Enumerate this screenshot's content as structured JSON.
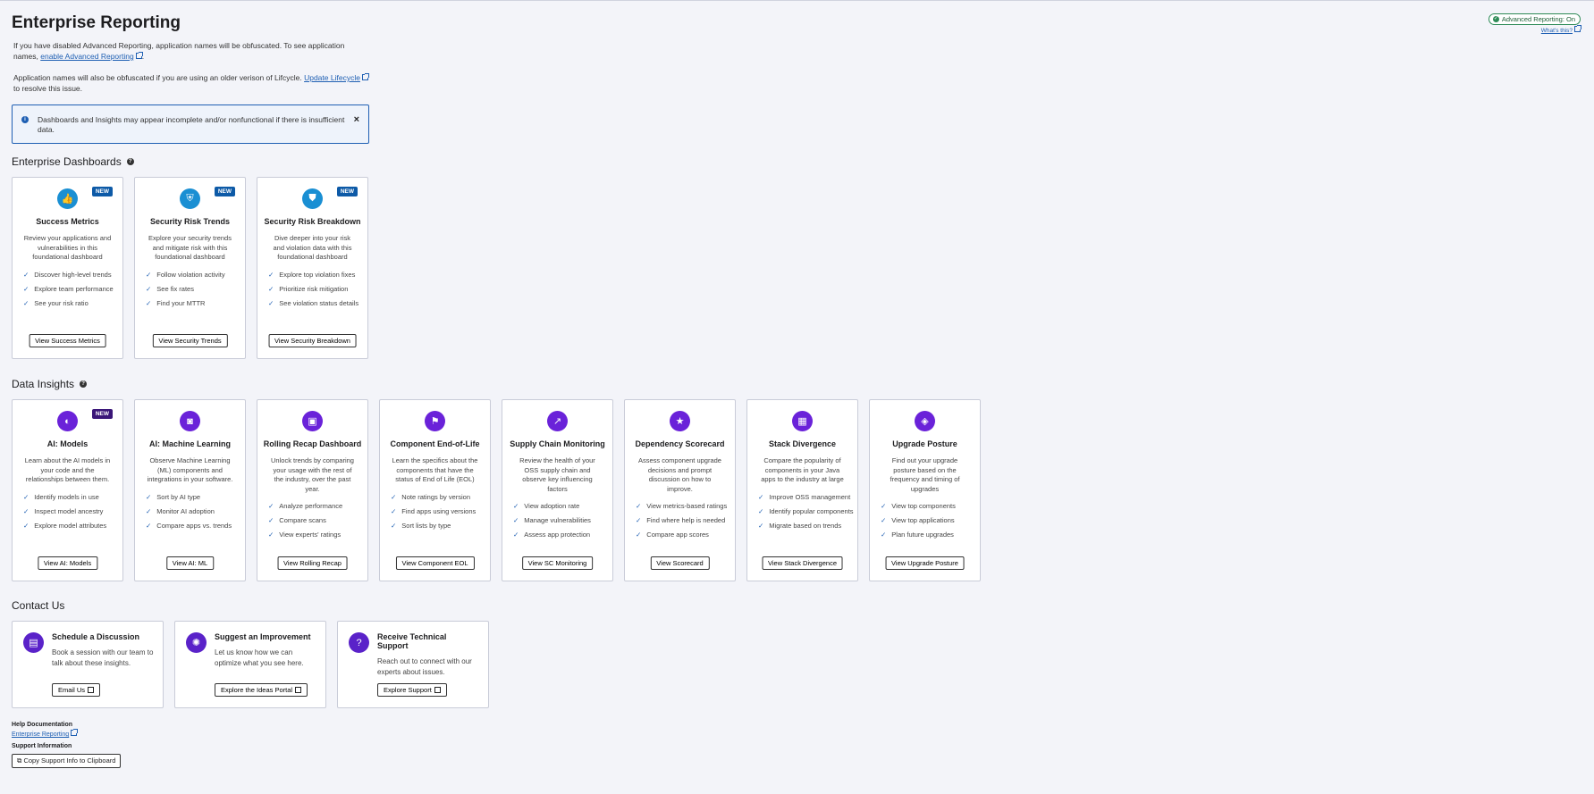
{
  "header": {
    "title": "Enterprise Reporting",
    "status_pill": "Advanced Reporting: On",
    "whats_this": "What's this?"
  },
  "intro": {
    "p1_text": "If you have disabled Advanced Reporting, application names will be obfuscated. To see application names,",
    "p1_link": "enable Advanced Reporting",
    "p1_end": ".",
    "p2_text": "Application names will also be obfuscated if you are using an older verison of Lifcycle.",
    "p2_link": "Update Lifecycle",
    "p2_end": "to resolve this issue."
  },
  "alert": {
    "text": "Dashboards and Insights may appear incomplete and/or nonfunctional if there is insufficient data.",
    "close": "×"
  },
  "dashboards": {
    "heading": "Enterprise Dashboards",
    "cards": [
      {
        "title": "Success Metrics",
        "badge": "NEW",
        "icon": "thumbs-up-icon",
        "glyph": "👍",
        "desc": "Review your applications and vulnerabilities in this foundational dashboard",
        "items": [
          "Discover high-level trends",
          "Explore team performance",
          "See your risk ratio"
        ],
        "button": "View Success Metrics"
      },
      {
        "title": "Security Risk Trends",
        "badge": "NEW",
        "icon": "shield-icon",
        "glyph": "⛨",
        "desc": "Explore your security trends and mitigate risk with this foundational dashboard",
        "items": [
          "Follow violation activity",
          "See fix rates",
          "Find your MTTR"
        ],
        "button": "View Security Trends"
      },
      {
        "title": "Security Risk Breakdown",
        "badge": "NEW",
        "icon": "shield-half-icon",
        "glyph": "⛊",
        "desc": "Dive deeper into your risk and violation data with this foundational dashboard",
        "items": [
          "Explore top violation fixes",
          "Prioritize risk mitigation",
          "See violation status details"
        ],
        "button": "View Security Breakdown"
      }
    ]
  },
  "insights": {
    "heading": "Data Insights",
    "cards": [
      {
        "title": "AI: Models",
        "badge": "NEW",
        "icon": "brain-icon",
        "glyph": "◐",
        "desc": "Learn about the AI models in your code and the relationships between them.",
        "items": [
          "Identify models in use",
          "Inspect model ancestry",
          "Explore model attributes"
        ],
        "button": "View AI: Models"
      },
      {
        "title": "AI: Machine Learning",
        "badge": "",
        "icon": "robot-icon",
        "glyph": "◙",
        "desc": "Observe Machine Learning (ML) components and integrations in your software.",
        "items": [
          "Sort by AI type",
          "Monitor AI adoption",
          "Compare apps vs. trends"
        ],
        "button": "View AI: ML"
      },
      {
        "title": "Rolling Recap Dashboard",
        "badge": "",
        "icon": "calendar-check-icon",
        "glyph": "▣",
        "desc": "Unlock trends by comparing your usage with the rest of the industry, over the past year.",
        "items": [
          "Analyze performance",
          "Compare scans",
          "View experts' ratings"
        ],
        "button": "View Rolling Recap"
      },
      {
        "title": "Component End-of-Life",
        "badge": "",
        "icon": "flag-checkered-icon",
        "glyph": "⚑",
        "desc": "Learn the specifics about the components that have the status of End of Life (EOL)",
        "items": [
          "Note ratings by version",
          "Find apps using versions",
          "Sort lists by type"
        ],
        "button": "View Component EOL"
      },
      {
        "title": "Supply Chain Monitoring",
        "badge": "",
        "icon": "chart-line-icon",
        "glyph": "↗",
        "desc": "Review the health of your OSS supply chain and observe key influencing factors",
        "items": [
          "View adoption rate",
          "Manage vulnerabilities",
          "Assess app protection"
        ],
        "button": "View SC Monitoring"
      },
      {
        "title": "Dependency Scorecard",
        "badge": "",
        "icon": "star-badge-icon",
        "glyph": "★",
        "desc": "Assess component upgrade decisions and prompt discussion on how to improve.",
        "items": [
          "View metrics-based ratings",
          "Find where help is needed",
          "Compare app scores"
        ],
        "button": "View Scorecard"
      },
      {
        "title": "Stack Divergence",
        "badge": "",
        "icon": "table-icon",
        "glyph": "▦",
        "desc": "Compare the popularity of components in your Java apps to the industry at large",
        "items": [
          "Improve OSS management",
          "Identify popular components",
          "Migrate based on trends"
        ],
        "button": "View Stack Divergence"
      },
      {
        "title": "Upgrade Posture",
        "badge": "",
        "icon": "layers-up-icon",
        "glyph": "◈",
        "desc": "Find out your upgrade posture based on the frequency and timing of upgrades",
        "items": [
          "View top components",
          "View top applications",
          "Plan future upgrades"
        ],
        "button": "View Upgrade Posture"
      }
    ]
  },
  "contact": {
    "heading": "Contact Us",
    "cards": [
      {
        "title": "Schedule a Discussion",
        "icon": "calendar-icon",
        "glyph": "▤",
        "desc": "Book a session with our team to talk about these insights.",
        "button": "Email Us"
      },
      {
        "title": "Suggest an Improvement",
        "icon": "lightbulb-icon",
        "glyph": "✺",
        "desc": "Let us know how we can optimize what you see here.",
        "button": "Explore the Ideas Portal"
      },
      {
        "title": "Receive Technical Support",
        "icon": "question-icon",
        "glyph": "?",
        "desc": "Reach out to connect with our experts about issues.",
        "button": "Explore Support"
      }
    ]
  },
  "footer": {
    "help_label": "Help Documentation",
    "help_link": "Enterprise Reporting",
    "support_label": "Support Information",
    "copy_button": "Copy Support Info to Clipboard"
  }
}
